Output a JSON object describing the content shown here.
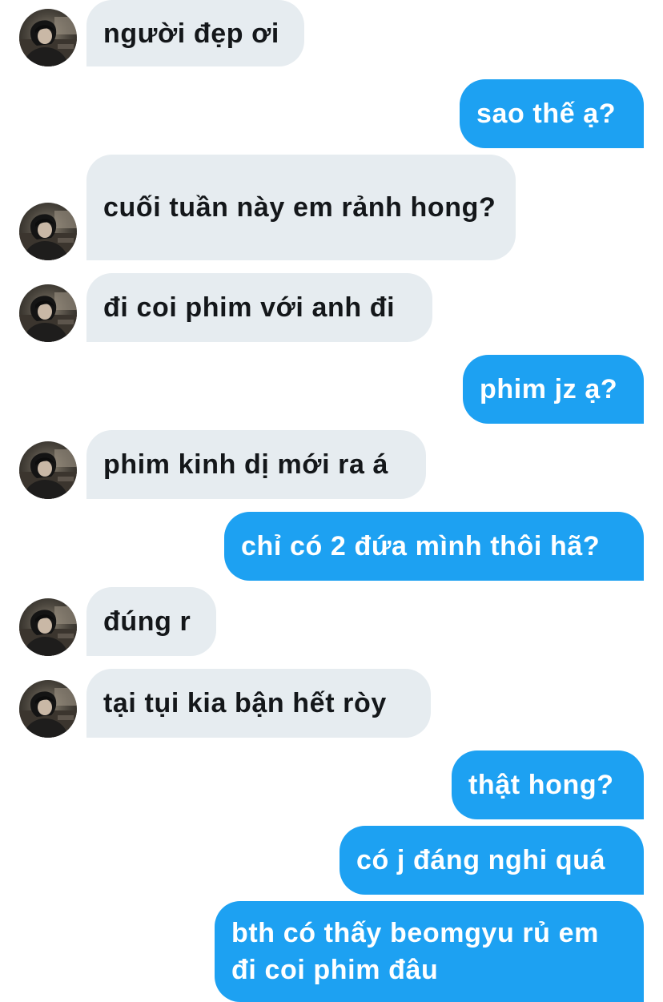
{
  "conversation": {
    "messages": [
      {
        "side": "in",
        "text": "người đẹp ơi",
        "avatar": true
      },
      {
        "side": "out",
        "text": "sao thế ạ?"
      },
      {
        "side": "in",
        "text": "cuối tuần này em rảnh hong?",
        "avatar": true
      },
      {
        "side": "in",
        "text": "đi coi phim với anh đi",
        "avatar": true
      },
      {
        "side": "out",
        "text": "phim jz ạ?"
      },
      {
        "side": "in",
        "text": "phim kinh dị mới ra á",
        "avatar": true
      },
      {
        "side": "out",
        "text": "chỉ có 2 đứa mình thôi hã?"
      },
      {
        "side": "in",
        "text": "đúng r",
        "avatar": true
      },
      {
        "side": "in",
        "text": "tại tụi kia bận hết ròy",
        "avatar": true
      },
      {
        "side": "out",
        "text": "thật hong?"
      },
      {
        "side": "out",
        "text": "có j đáng nghi quá"
      },
      {
        "side": "out",
        "text": "bth có thấy beomgyu rủ em đi coi phim đâu"
      }
    ]
  },
  "colors": {
    "incoming_bubble": "#e6ecf0",
    "incoming_text": "#14171a",
    "outgoing_bubble": "#1da1f2",
    "outgoing_text": "#ffffff"
  },
  "icons": {
    "avatar": "contact-avatar-photo"
  }
}
